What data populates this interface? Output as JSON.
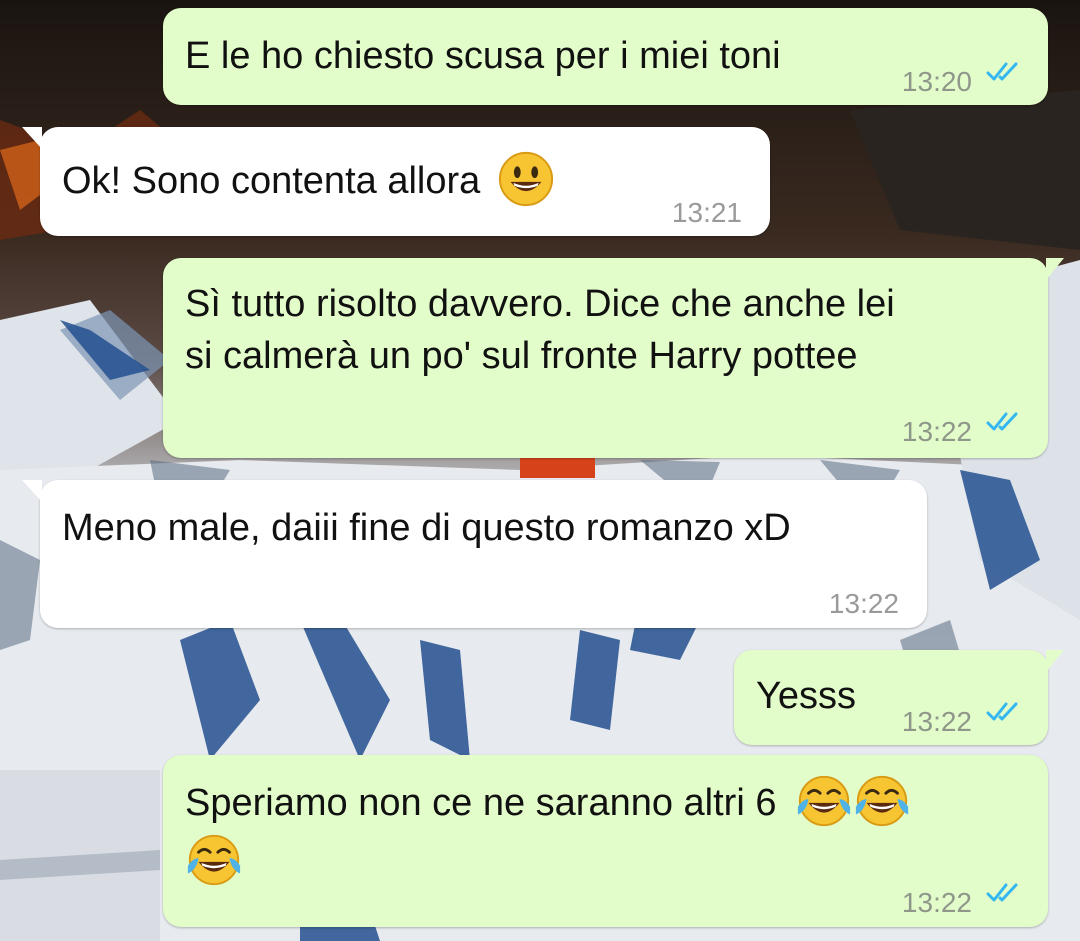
{
  "chat": {
    "messages": [
      {
        "direction": "outgoing",
        "lines": [
          "E le ho chiesto scusa per i miei toni"
        ],
        "time": "13:20",
        "status": "read"
      },
      {
        "direction": "incoming",
        "lines": [
          "Ok! Sono contenta allora"
        ],
        "emoji": [
          "smiling-face"
        ],
        "time": "13:21"
      },
      {
        "direction": "outgoing",
        "lines": [
          "Sì tutto risolto davvero. Dice che anche lei",
          "si calmerà un po' sul fronte Harry pottee"
        ],
        "time": "13:22",
        "status": "read"
      },
      {
        "direction": "incoming",
        "lines": [
          "Meno male, daiii fine di questo romanzo xD"
        ],
        "time": "13:22"
      },
      {
        "direction": "outgoing",
        "lines": [
          "Yesss"
        ],
        "time": "13:22",
        "status": "read"
      },
      {
        "direction": "outgoing",
        "lines": [
          "Speriamo non ce ne saranno altri 6"
        ],
        "emoji": [
          "tears-of-joy",
          "tears-of-joy",
          "tears-of-joy"
        ],
        "time": "13:22",
        "status": "read"
      }
    ]
  },
  "colors": {
    "outgoing_bubble": "#e2fdc9",
    "incoming_bubble": "#ffffff",
    "read_ticks": "#34b7f1",
    "timestamp": "#8f978b"
  }
}
